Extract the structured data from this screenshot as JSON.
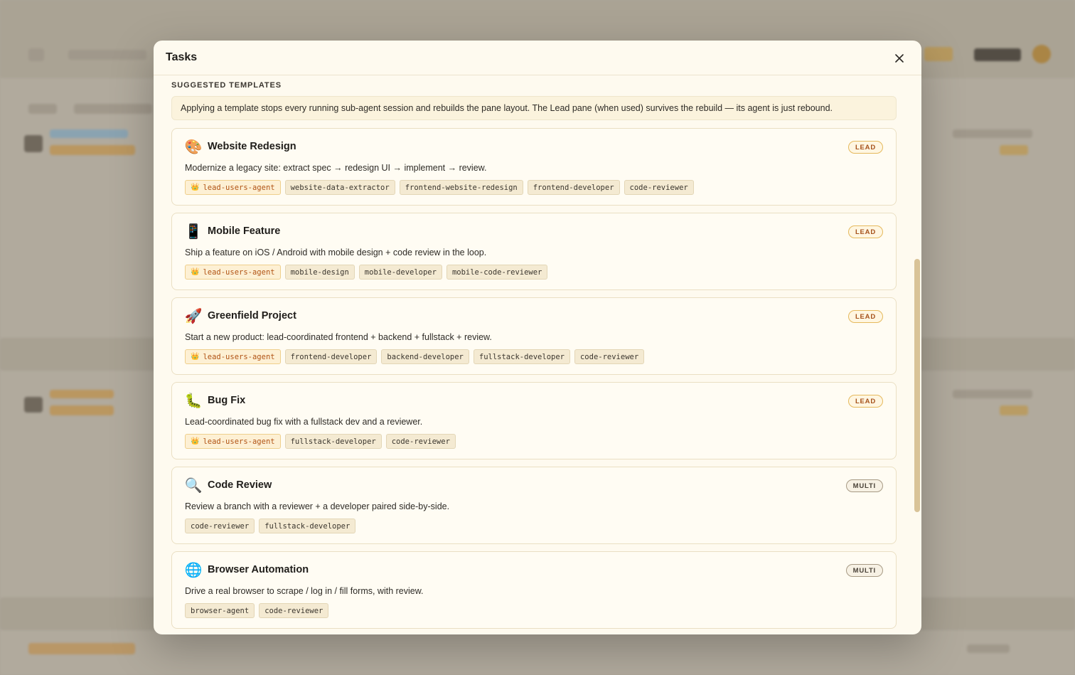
{
  "modal": {
    "title": "Tasks",
    "section_label": "SUGGESTED TEMPLATES",
    "notice": "Applying a template stops every running sub-agent session and rebuilds the pane layout. The Lead pane (when used) survives the rebuild — its agent is just rebound."
  },
  "templates": [
    {
      "icon": "paintbrush-icon",
      "title": "Website Redesign",
      "badge": "LEAD",
      "description": "Modernize a legacy site: extract spec → redesign UI → implement → review.",
      "agents": [
        {
          "name": "lead-users-agent",
          "lead": true
        },
        {
          "name": "website-data-extractor",
          "lead": false
        },
        {
          "name": "frontend-website-redesign",
          "lead": false
        },
        {
          "name": "frontend-developer",
          "lead": false
        },
        {
          "name": "code-reviewer",
          "lead": false
        }
      ]
    },
    {
      "icon": "mobile-phone-icon",
      "title": "Mobile Feature",
      "badge": "LEAD",
      "description": "Ship a feature on iOS / Android with mobile design + code review in the loop.",
      "agents": [
        {
          "name": "lead-users-agent",
          "lead": true
        },
        {
          "name": "mobile-design",
          "lead": false
        },
        {
          "name": "mobile-developer",
          "lead": false
        },
        {
          "name": "mobile-code-reviewer",
          "lead": false
        }
      ]
    },
    {
      "icon": "rocket-icon",
      "title": "Greenfield Project",
      "badge": "LEAD",
      "description": "Start a new product: lead-coordinated frontend + backend + fullstack + review.",
      "agents": [
        {
          "name": "lead-users-agent",
          "lead": true
        },
        {
          "name": "frontend-developer",
          "lead": false
        },
        {
          "name": "backend-developer",
          "lead": false
        },
        {
          "name": "fullstack-developer",
          "lead": false
        },
        {
          "name": "code-reviewer",
          "lead": false
        }
      ]
    },
    {
      "icon": "bug-icon",
      "title": "Bug Fix",
      "badge": "LEAD",
      "description": "Lead-coordinated bug fix with a fullstack dev and a reviewer.",
      "agents": [
        {
          "name": "lead-users-agent",
          "lead": true
        },
        {
          "name": "fullstack-developer",
          "lead": false
        },
        {
          "name": "code-reviewer",
          "lead": false
        }
      ]
    },
    {
      "icon": "magnifier-icon",
      "title": "Code Review",
      "badge": "MULTI",
      "description": "Review a branch with a reviewer + a developer paired side-by-side.",
      "agents": [
        {
          "name": "code-reviewer",
          "lead": false
        },
        {
          "name": "fullstack-developer",
          "lead": false
        }
      ]
    },
    {
      "icon": "globe-icon",
      "title": "Browser Automation",
      "badge": "MULTI",
      "description": "Drive a real browser to scrape / log in / fill forms, with review.",
      "agents": [
        {
          "name": "browser-agent",
          "lead": false
        },
        {
          "name": "code-reviewer",
          "lead": false
        }
      ]
    }
  ],
  "colors": {
    "accent": "#b15314",
    "modal_bg": "#fefaef",
    "card_border": "#eadfc3"
  }
}
